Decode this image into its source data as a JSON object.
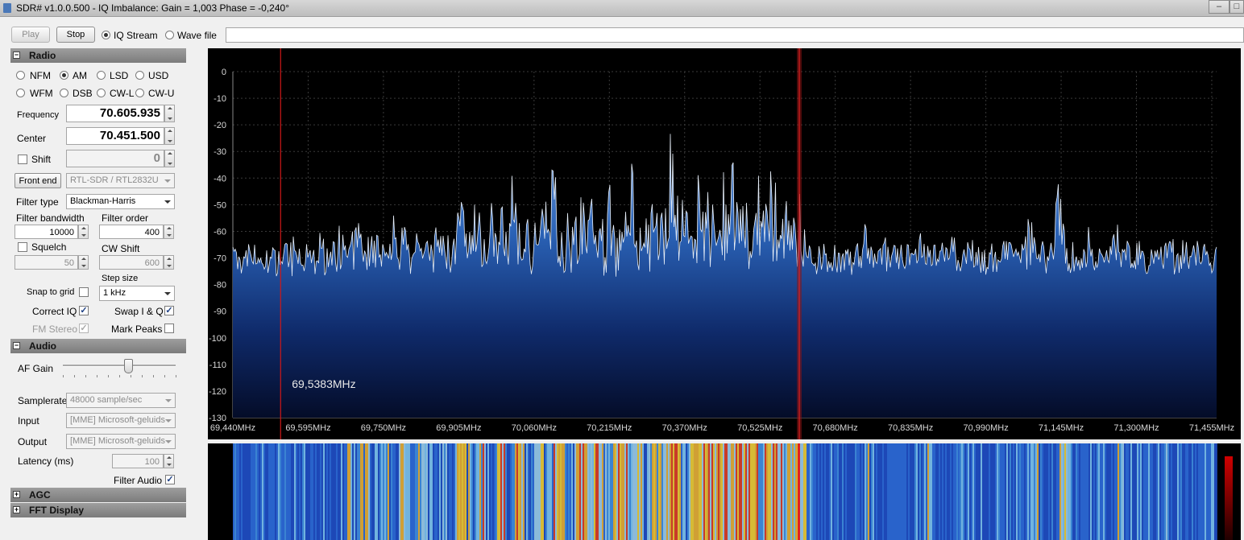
{
  "window": {
    "title": "SDR# v1.0.0.500 - IQ Imbalance: Gain = 1,003 Phase = -0,240°"
  },
  "toolbar": {
    "play_label": "Play",
    "stop_label": "Stop",
    "iq_stream_label": "IQ Stream",
    "wave_file_label": "Wave file",
    "source": "iq_stream"
  },
  "radio": {
    "section_title": "Radio",
    "modes": [
      {
        "label": "NFM",
        "selected": false
      },
      {
        "label": "AM",
        "selected": true
      },
      {
        "label": "LSD",
        "selected": false
      },
      {
        "label": "USD",
        "selected": false
      },
      {
        "label": "WFM",
        "selected": false
      },
      {
        "label": "DSB",
        "selected": false
      },
      {
        "label": "CW-L",
        "selected": false
      },
      {
        "label": "CW-U",
        "selected": false
      }
    ],
    "frequency_label": "Frequency",
    "frequency_value": "70.605.935",
    "center_label": "Center",
    "center_value": "70.451.500",
    "shift_label": "Shift",
    "shift_value": "0",
    "front_end_label": "Front end",
    "front_end_value": "RTL-SDR / RTL2832U",
    "filter_type_label": "Filter type",
    "filter_type_value": "Blackman-Harris",
    "filter_bandwidth_label": "Filter bandwidth",
    "filter_bandwidth_value": "10000",
    "filter_order_label": "Filter order",
    "filter_order_value": "400",
    "squelch_label": "Squelch",
    "squelch_value": "50",
    "cw_shift_label": "CW Shift",
    "cw_shift_value": "600",
    "step_size_label": "Step size",
    "step_size_value": "1 kHz",
    "snap_to_grid_label": "Snap to grid",
    "snap_to_grid_checked": false,
    "correct_iq_label": "Correct IQ",
    "correct_iq_checked": true,
    "swap_iq_label": "Swap I & Q",
    "swap_iq_checked": true,
    "fm_stereo_label": "FM Stereo",
    "fm_stereo_checked": true,
    "mark_peaks_label": "Mark Peaks",
    "mark_peaks_checked": false
  },
  "audio": {
    "section_title": "Audio",
    "af_gain_label": "AF Gain",
    "af_gain_level": 0.58,
    "samplerate_label": "Samplerate",
    "samplerate_value": "48000 sample/sec",
    "input_label": "Input",
    "input_value": "[MME] Microsoft-geluids",
    "output_label": "Output",
    "output_value": "[MME] Microsoft-geluids",
    "latency_label": "Latency (ms)",
    "latency_value": "100",
    "filter_audio_label": "Filter Audio",
    "filter_audio_checked": true
  },
  "agc": {
    "section_title": "AGC"
  },
  "fft_display": {
    "section_title": "FFT Display"
  },
  "chart_data": {
    "type": "area",
    "xlabel": "",
    "ylabel": "",
    "x_unit": "MHz",
    "xlim": [
      69.44,
      71.465
    ],
    "ylim": [
      -130,
      0
    ],
    "x_ticks": [
      {
        "v": 69.44,
        "label": "69,440MHz"
      },
      {
        "v": 69.595,
        "label": "69,595MHz"
      },
      {
        "v": 69.75,
        "label": "69,750MHz"
      },
      {
        "v": 69.905,
        "label": "69,905MHz"
      },
      {
        "v": 70.06,
        "label": "70,060MHz"
      },
      {
        "v": 70.215,
        "label": "70,215MHz"
      },
      {
        "v": 70.37,
        "label": "70,370MHz"
      },
      {
        "v": 70.525,
        "label": "70,525MHz"
      },
      {
        "v": 70.68,
        "label": "70,680MHz"
      },
      {
        "v": 70.835,
        "label": "70,835MHz"
      },
      {
        "v": 70.99,
        "label": "70,990MHz"
      },
      {
        "v": 71.145,
        "label": "71,145MHz"
      },
      {
        "v": 71.3,
        "label": "71,300MHz"
      },
      {
        "v": 71.455,
        "label": "71,455MHz"
      }
    ],
    "y_ticks": [
      0,
      -10,
      -20,
      -30,
      -40,
      -50,
      -60,
      -70,
      -80,
      -90,
      -100,
      -110,
      -120,
      -130
    ],
    "grid": true,
    "cursor_freq": 69.5383,
    "cursor_label": "69,5383MHz",
    "tuned_freq": 70.6059,
    "series": [
      {
        "x": [
          69.44,
          69.46,
          69.48,
          69.5,
          69.52,
          69.54,
          69.56,
          69.58,
          69.6,
          69.62,
          69.64,
          69.66,
          69.68,
          69.7,
          69.72,
          69.74,
          69.76,
          69.78,
          69.8,
          69.82,
          69.84,
          69.86,
          69.88,
          69.9,
          69.92,
          69.94,
          69.96,
          69.98,
          70.0,
          70.02,
          70.04,
          70.06,
          70.08,
          70.1,
          70.12,
          70.14,
          70.16,
          70.18,
          70.2,
          70.22,
          70.24,
          70.26,
          70.28,
          70.3,
          70.32,
          70.34,
          70.36,
          70.38,
          70.4,
          70.42,
          70.44,
          70.46,
          70.48,
          70.5,
          70.52,
          70.54,
          70.56,
          70.58,
          70.6,
          70.62,
          70.64,
          70.66,
          70.68,
          70.7,
          70.72,
          70.74,
          70.76,
          70.78,
          70.8,
          70.82,
          70.84,
          70.86,
          70.88,
          70.9,
          70.92,
          70.94,
          70.96,
          70.98,
          71.0,
          71.02,
          71.04,
          71.06,
          71.08,
          71.1,
          71.12,
          71.14,
          71.16,
          71.18,
          71.2,
          71.22,
          71.24,
          71.26,
          71.28,
          71.3,
          71.32,
          71.34,
          71.36,
          71.38,
          71.4,
          71.42,
          71.44,
          71.46
        ],
        "y": [
          -66,
          -70,
          -64,
          -72,
          -62,
          -68,
          -59,
          -70,
          -65,
          -60,
          -68,
          -57,
          -66,
          -50,
          -63,
          -55,
          -68,
          -42,
          -61,
          -48,
          -66,
          -52,
          -60,
          -35,
          -58,
          -45,
          -63,
          -38,
          -55,
          -30,
          -58,
          -43,
          -52,
          -34,
          -60,
          -40,
          -48,
          -28,
          -55,
          -36,
          -45,
          -30,
          -58,
          -38,
          -40,
          -22,
          -50,
          -32,
          -36,
          -25,
          -42,
          -30,
          -35,
          -24,
          -40,
          -28,
          -44,
          -48,
          -33,
          -66,
          -70,
          -68,
          -62,
          -72,
          -65,
          -55,
          -70,
          -66,
          -62,
          -71,
          -68,
          -58,
          -72,
          -66,
          -64,
          -70,
          -60,
          -74,
          -68,
          -65,
          -62,
          -70,
          -52,
          -68,
          -66,
          -40,
          -64,
          -70,
          -58,
          -66,
          -72,
          -55,
          -68,
          -60,
          -70,
          -64,
          -58,
          -68,
          -62,
          -66,
          -64,
          -70
        ]
      }
    ]
  }
}
